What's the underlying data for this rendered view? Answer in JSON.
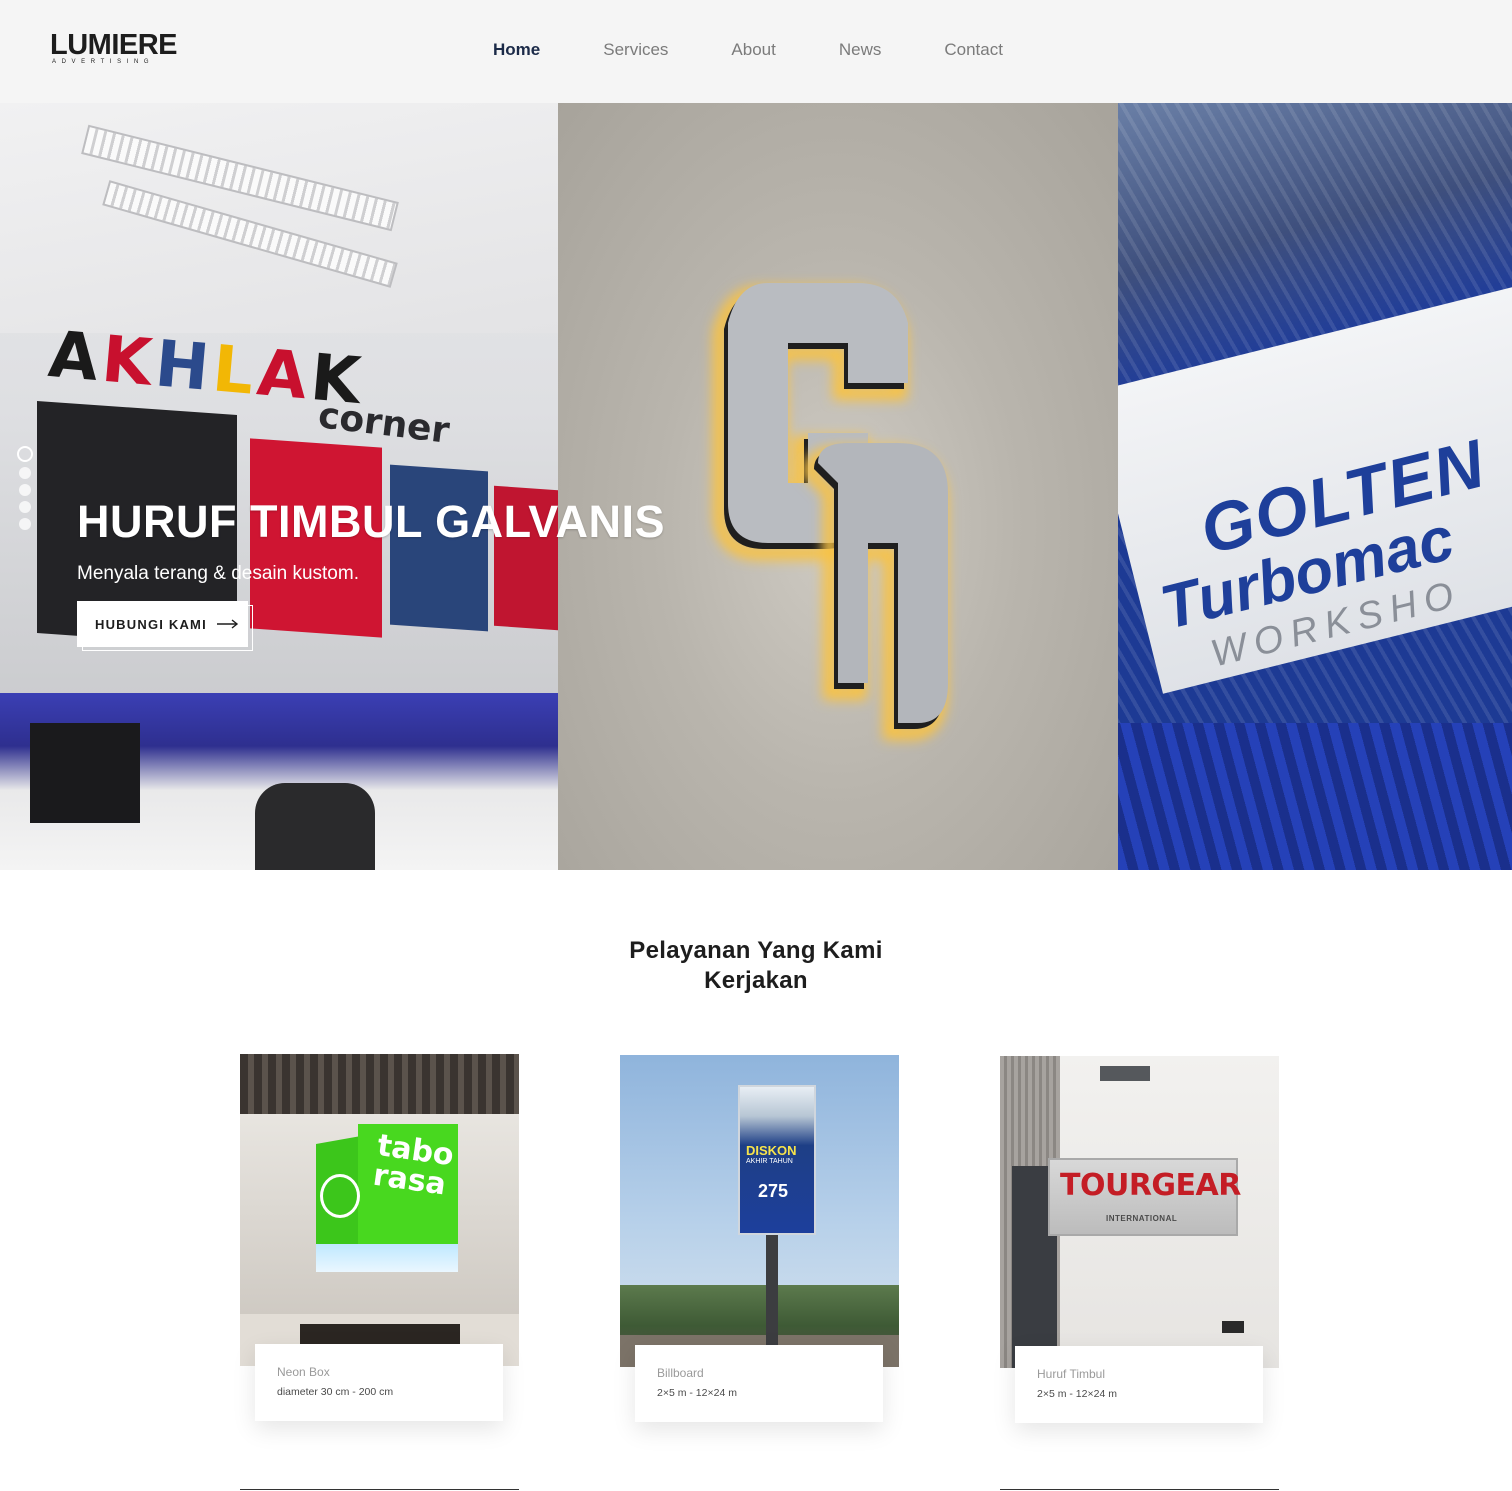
{
  "header": {
    "logo_main": "LUMIERE",
    "logo_sub": "ADVERTISING",
    "nav": [
      {
        "label": "Home",
        "active": true
      },
      {
        "label": "Services",
        "active": false
      },
      {
        "label": "About",
        "active": false
      },
      {
        "label": "News",
        "active": false
      },
      {
        "label": "Contact",
        "active": false
      }
    ]
  },
  "hero": {
    "title": "HURUF TIMBUL GALVANIS",
    "subtitle": "Menyala terang & desain kustom.",
    "cta_label": "HUBUNGI KAMI",
    "cta_icon": "arrow-right-icon",
    "slide_count": 5,
    "active_slide": 1,
    "photo_texts": {
      "akhlak": [
        "A",
        "K",
        "H",
        "L",
        "A",
        "K"
      ],
      "corner": "corner",
      "golten_1": "GOLTEN",
      "golten_2": "Turbomac",
      "golten_3": "WORKSHO"
    }
  },
  "services": {
    "title_line1": "Pelayanan Yang Kami",
    "title_line2": "Kerjakan",
    "items": [
      {
        "name": "Neon Box",
        "size": "diameter 30 cm - 200 cm",
        "photo_texts": [
          "tabo",
          "rasa"
        ]
      },
      {
        "name": "Billboard",
        "size": "2×5 m - 12×24 m",
        "photo_texts": [
          "DISKON",
          "AKHIR TAHUN",
          "275"
        ]
      },
      {
        "name": "Huruf Timbul",
        "size": "2×5 m - 12×24 m",
        "photo_texts": [
          "TOURGEAR",
          "INTERNATIONAL"
        ]
      }
    ]
  },
  "colors": {
    "header_bg": "#f5f5f5",
    "nav_active": "#1b2a48",
    "nav_inactive": "#7b7b7b",
    "hero_text": "#ffffff"
  }
}
